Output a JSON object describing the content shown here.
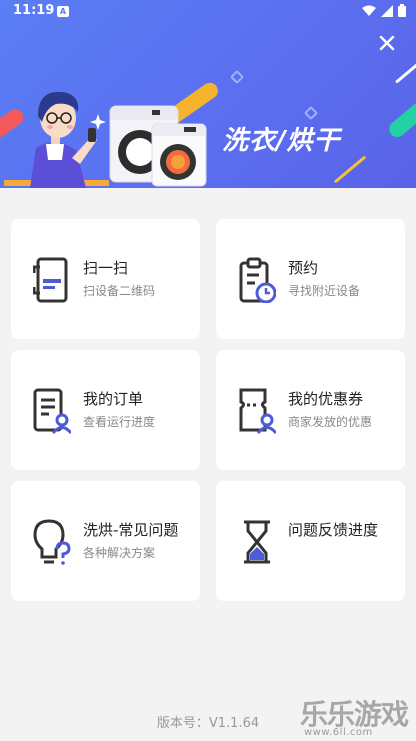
{
  "status": {
    "time": "11:19",
    "app_badge": "A"
  },
  "banner": {
    "title": "洗衣/烘干",
    "close_icon": "close-icon"
  },
  "menu": [
    {
      "title": "扫一扫",
      "subtitle": "扫设备二维码",
      "icon": "scan-phone-icon"
    },
    {
      "title": "预约",
      "subtitle": "寻找附近设备",
      "icon": "clipboard-clock-icon"
    },
    {
      "title": "我的订单",
      "subtitle": "查看运行进度",
      "icon": "order-user-icon"
    },
    {
      "title": "我的优惠券",
      "subtitle": "商家发放的优惠",
      "icon": "coupon-user-icon"
    },
    {
      "title": "洗烘-常见问题",
      "subtitle": "各种解决方案",
      "icon": "lightbulb-question-icon"
    },
    {
      "title": "问题反馈进度",
      "subtitle": "",
      "icon": "hourglass-icon"
    }
  ],
  "footer": {
    "version": "版本号：V1.1.64"
  },
  "watermark": {
    "brand": "乐乐游戏",
    "url": "www.6ll.com"
  },
  "colors": {
    "accent": "#5b6ff0",
    "icon_dark": "#333333",
    "icon_accent": "#4d5bd6"
  }
}
